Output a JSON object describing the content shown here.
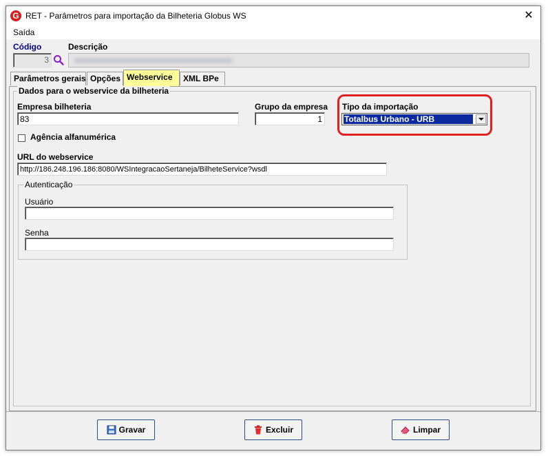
{
  "window": {
    "title": "RET - Parâmetros para importação da Bilheteria Globus WS",
    "icon_letter": "G",
    "close_glyph": "✕"
  },
  "menu": {
    "items": [
      {
        "label": "Saída"
      }
    ]
  },
  "header": {
    "codigo_label": "Código",
    "codigo_value": "3",
    "descricao_label": "Descrição"
  },
  "tabs": [
    {
      "label": "Parâmetros gerais",
      "active": false
    },
    {
      "label": "Opções",
      "active": false
    },
    {
      "label": "Webservice",
      "active": true
    },
    {
      "label": "XML BPe",
      "active": false
    }
  ],
  "webservice": {
    "group_title": "Dados para o webservice da bilheteria",
    "empresa_label": "Empresa bilheteria",
    "empresa_value": "83",
    "grupo_label": "Grupo da empresa",
    "grupo_value": "1",
    "tipo_label": "Tipo da importação",
    "tipo_value": "Totalbus Urbano - URB",
    "agencia_label": "Agência alfanumérica",
    "agencia_checked": false,
    "url_label": "URL do webservice",
    "url_value": "http://186.248.196.186:8080/WSIntegracaoSertaneja/BilheteService?wsdl",
    "auth": {
      "title": "Autenticação",
      "usuario_label": "Usuário",
      "usuario_value": "",
      "senha_label": "Senha",
      "senha_value": ""
    }
  },
  "buttons": {
    "gravar": "Gravar",
    "excluir": "Excluir",
    "limpar": "Limpar"
  },
  "colors": {
    "active_tab": "#ffff99",
    "selection": "#0b2a9e",
    "highlight": "#e02020",
    "label_blue": "#000080"
  }
}
